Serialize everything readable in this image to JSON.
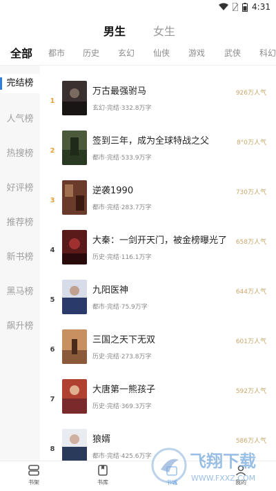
{
  "status": {
    "time": "4:31"
  },
  "gender_tabs": [
    {
      "label": "男生",
      "active": true
    },
    {
      "label": "女生",
      "active": false
    }
  ],
  "categories": [
    "全部",
    "都市",
    "历史",
    "玄幻",
    "仙侠",
    "游戏",
    "武侠",
    "科幻"
  ],
  "sidebar": [
    {
      "label": "完结榜",
      "active": true
    },
    {
      "label": "人气榜"
    },
    {
      "label": "热搜榜"
    },
    {
      "label": "好评榜"
    },
    {
      "label": "推荐榜"
    },
    {
      "label": "新书榜"
    },
    {
      "label": "黑马榜"
    },
    {
      "label": "飙升榜"
    }
  ],
  "books": [
    {
      "rank": "1",
      "title": "万古最强驸马",
      "meta": "玄幻·完结·332.8万字",
      "popularity": "926万人气",
      "cover": "#3a3030"
    },
    {
      "rank": "2",
      "title": "签到三年，成为全球特战之父",
      "meta": "都市·完结·533.9万字",
      "popularity": "8°0万人气",
      "cover": "#4a5a3a"
    },
    {
      "rank": "3",
      "title": "逆袭1990",
      "meta": "都市·完结·283.7万字",
      "popularity": "730万人气",
      "cover": "#6a3a2a"
    },
    {
      "rank": "4",
      "title": "大秦：一剑开天门，被金榜曝光了",
      "meta": "历史·完结·116.1万字",
      "popularity": "658万人气",
      "cover": "#5a1a1a"
    },
    {
      "rank": "5",
      "title": "九阳医神",
      "meta": "都市·完结·75.9万字",
      "popularity": "644万人气",
      "cover": "#2a3a6a"
    },
    {
      "rank": "6",
      "title": "三国之天下无双",
      "meta": "历史·完结·273.8万字",
      "popularity": "601万人气",
      "cover": "#8a5a3a"
    },
    {
      "rank": "7",
      "title": "大唐第一熊孩子",
      "meta": "历史·完结·369.3万字",
      "popularity": "592万人气",
      "cover": "#7a2a2a"
    },
    {
      "rank": "8",
      "title": "狼婿",
      "meta": "都市·完结·425.6万字",
      "popularity": "586万人气",
      "cover": "#2a3a5a"
    }
  ],
  "bottom_nav": [
    {
      "label": "书架",
      "icon": "bookshelf-icon",
      "active": false
    },
    {
      "label": "书库",
      "icon": "library-icon",
      "active": false
    },
    {
      "label": "书城",
      "icon": "bookstore-icon",
      "active": true
    },
    {
      "label": "我的",
      "icon": "profile-icon",
      "active": false
    }
  ],
  "watermark": {
    "text": "飞翔下载",
    "url": "WWW.FXXZ.COM"
  },
  "colors": {
    "accent": "#2f7de1",
    "gold": "#e6a23c",
    "popularity": "#c9a66b"
  }
}
